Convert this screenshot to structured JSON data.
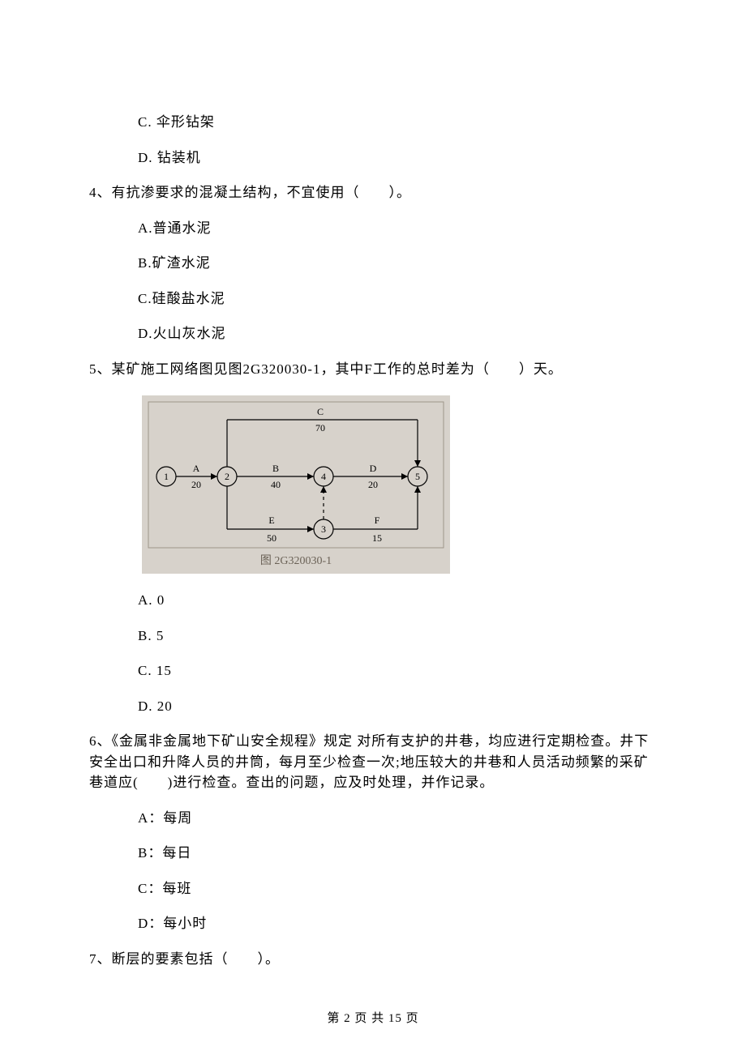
{
  "q3": {
    "optC": "C.  伞形钻架",
    "optD": "D.  钻装机"
  },
  "q4": {
    "text": "4、有抗渗要求的混凝土结构，不宜使用（　　）。",
    "optA": "A.普通水泥",
    "optB": "B.矿渣水泥",
    "optC": "C.硅酸盐水泥",
    "optD": "D.火山灰水泥"
  },
  "q5": {
    "text": "5、某矿施工网络图见图2G320030-1，其中F工作的总时差为（　　）天。",
    "optA": "A.  0",
    "optB": "B.  5",
    "optC": "C.  15",
    "optD": "D.  20",
    "diagram_caption": "图 2G320030-1"
  },
  "q6": {
    "text": "6、《金属非金属地下矿山安全规程》规定 对所有支护的井巷，均应进行定期检查。井下安全出口和升降人员的井筒，每月至少检查一次;地压较大的井巷和人员活动频繁的采矿巷道应(　　)进行检查。查出的问题，应及时处理，并作记录。",
    "optA": "A：每周",
    "optB": "B：每日",
    "optC": "C：每班",
    "optD": "D：每小时"
  },
  "q7": {
    "text": "7、断层的要素包括（　　）。"
  },
  "footer": "第 2 页 共 15 页",
  "chart_data": {
    "type": "diagram",
    "caption": "图 2G320030-1",
    "nodes": [
      "1",
      "2",
      "3",
      "4",
      "5"
    ],
    "edges": [
      {
        "name": "A",
        "from": "1",
        "to": "2",
        "duration": 20
      },
      {
        "name": "B",
        "from": "2",
        "to": "4",
        "duration": 40
      },
      {
        "name": "C",
        "from": "2",
        "to": "5",
        "duration": 70
      },
      {
        "name": "D",
        "from": "4",
        "to": "5",
        "duration": 20
      },
      {
        "name": "E",
        "from": "2",
        "to": "3",
        "duration": 50
      },
      {
        "name": "F",
        "from": "3",
        "to": "5",
        "duration": 15
      },
      {
        "name": "dummy",
        "from": "3",
        "to": "4",
        "duration": 0
      }
    ]
  }
}
